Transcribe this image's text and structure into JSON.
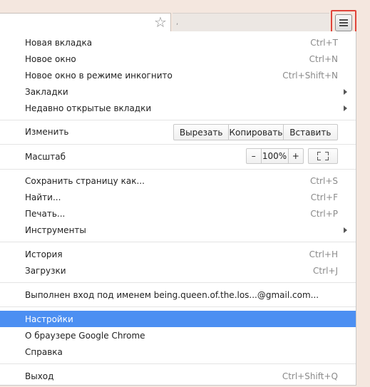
{
  "toolbar": {
    "tab_text": ",",
    "star_icon": "star-icon",
    "menu_icon": "hamburger-menu-icon"
  },
  "menu": {
    "new_tab": {
      "label": "Новая вкладка",
      "shortcut": "Ctrl+T"
    },
    "new_window": {
      "label": "Новое окно",
      "shortcut": "Ctrl+N"
    },
    "incognito": {
      "label": "Новое окно в режиме инкогнито",
      "shortcut": "Ctrl+Shift+N"
    },
    "bookmarks": {
      "label": "Закладки"
    },
    "recent_tabs": {
      "label": "Недавно открытые вкладки"
    },
    "edit": {
      "label": "Изменить",
      "cut": "Вырезать",
      "copy": "Копировать",
      "paste": "Вставить"
    },
    "zoom": {
      "label": "Масштаб",
      "minus": "–",
      "value": "100%",
      "plus": "+"
    },
    "save_page": {
      "label": "Сохранить страницу как...",
      "shortcut": "Ctrl+S"
    },
    "find": {
      "label": "Найти...",
      "shortcut": "Ctrl+F"
    },
    "print": {
      "label": "Печать...",
      "shortcut": "Ctrl+P"
    },
    "tools": {
      "label": "Инструменты"
    },
    "history": {
      "label": "История",
      "shortcut": "Ctrl+H"
    },
    "downloads": {
      "label": "Загрузки",
      "shortcut": "Ctrl+J"
    },
    "signed_in": {
      "label": "Выполнен вход под именем being.queen.of.the.los...@gmail.com..."
    },
    "settings": {
      "label": "Настройки"
    },
    "about": {
      "label": "О браузере Google Chrome"
    },
    "help": {
      "label": "Справка"
    },
    "exit": {
      "label": "Выход",
      "shortcut": "Ctrl+Shift+Q"
    }
  },
  "colors": {
    "highlight": "#4c8ff2",
    "menu_button_outline": "#e0443a",
    "background": "#f4e7df"
  }
}
